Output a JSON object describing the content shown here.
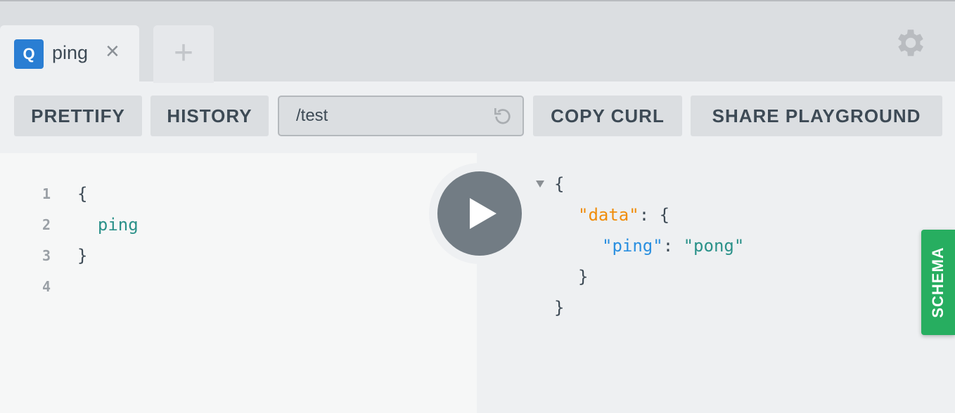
{
  "tabs": [
    {
      "badge": "Q",
      "label": "ping",
      "close": "×"
    }
  ],
  "add_tab": "+",
  "toolbar": {
    "prettify": "PRETTIFY",
    "history": "HISTORY",
    "endpoint": "/test",
    "copy_curl": "COPY CURL",
    "share": "SHARE PLAYGROUND"
  },
  "editor": {
    "line_numbers": [
      "1",
      "2",
      "3",
      "4"
    ],
    "lines": [
      "{",
      "  ping",
      "}",
      ""
    ]
  },
  "result": {
    "lines": [
      {
        "text": "{"
      },
      {
        "key": "\"data\"",
        "rest": ": {"
      },
      {
        "key": "\"ping\"",
        "sep": ": ",
        "value": "\"pong\""
      },
      {
        "text": "}"
      },
      {
        "text": "}"
      }
    ]
  },
  "schema_tab": "SCHEMA",
  "colors": {
    "accent": "#2a7ed3",
    "schema": "#27ae60",
    "key_orange": "#f08d0b",
    "key_blue": "#2a8fe0",
    "string_teal": "#2a9189"
  }
}
